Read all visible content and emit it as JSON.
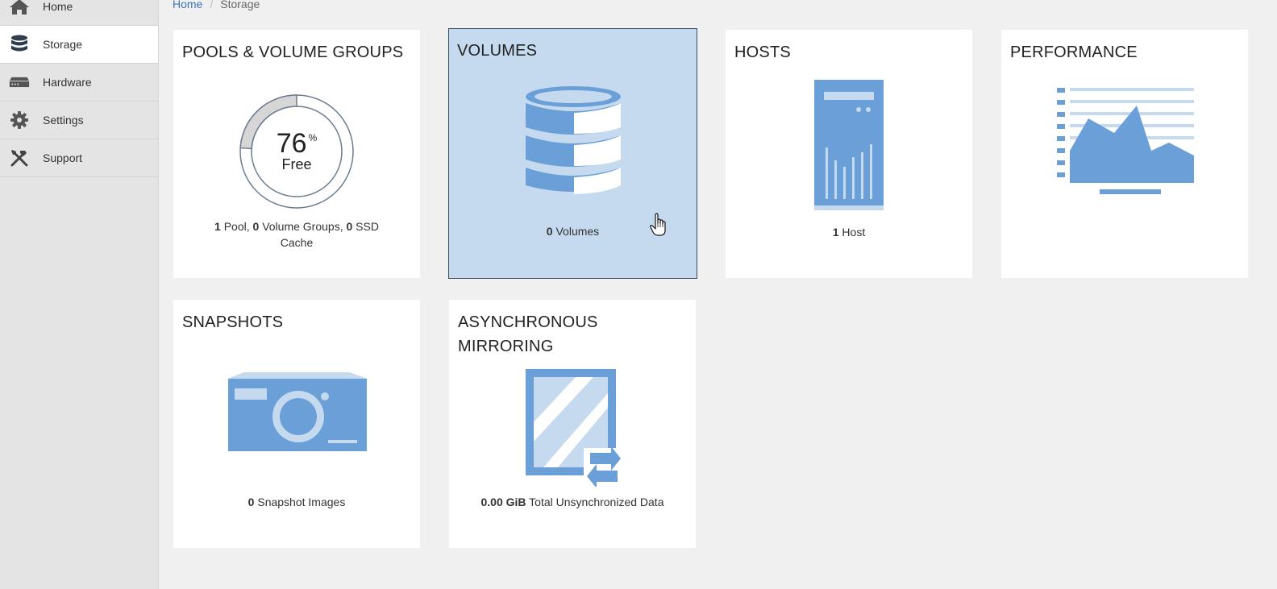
{
  "breadcrumb": {
    "home": "Home",
    "separator": "/",
    "current": "Storage"
  },
  "sidebar": {
    "items": [
      {
        "label": "Home",
        "icon": "home-icon"
      },
      {
        "label": "Storage",
        "icon": "database-icon",
        "active": true
      },
      {
        "label": "Hardware",
        "icon": "hardware-icon"
      },
      {
        "label": "Settings",
        "icon": "gear-icon"
      },
      {
        "label": "Support",
        "icon": "tools-icon"
      }
    ]
  },
  "tiles": {
    "pools": {
      "title": "POOLS & VOLUME GROUPS",
      "free_value": "76",
      "free_unit": "%",
      "free_label": "Free",
      "free_fraction": 0.76,
      "caption": {
        "n1": "1",
        "t1": " Pool, ",
        "n2": "0",
        "t2": " Volume Groups, ",
        "n3": "0",
        "t3": " SSD Cache"
      }
    },
    "volumes": {
      "title": "VOLUMES",
      "count": "0",
      "label": " Volumes",
      "selected": true
    },
    "hosts": {
      "title": "HOSTS",
      "count": "1",
      "label": " Host"
    },
    "performance": {
      "title": "PERFORMANCE"
    },
    "snapshots": {
      "title": "SNAPSHOTS",
      "count": "0",
      "label": " Snapshot Images"
    },
    "mirroring": {
      "title": "ASYNCHRONOUS MIRRORING",
      "amount": "0.00 GiB",
      "label": " Total Unsynchronized Data"
    }
  },
  "colors": {
    "accent": "#6a9fd8",
    "accent_light": "#c5daee",
    "link": "#3b73b9",
    "sidebar_bg": "#e4e4e4"
  }
}
